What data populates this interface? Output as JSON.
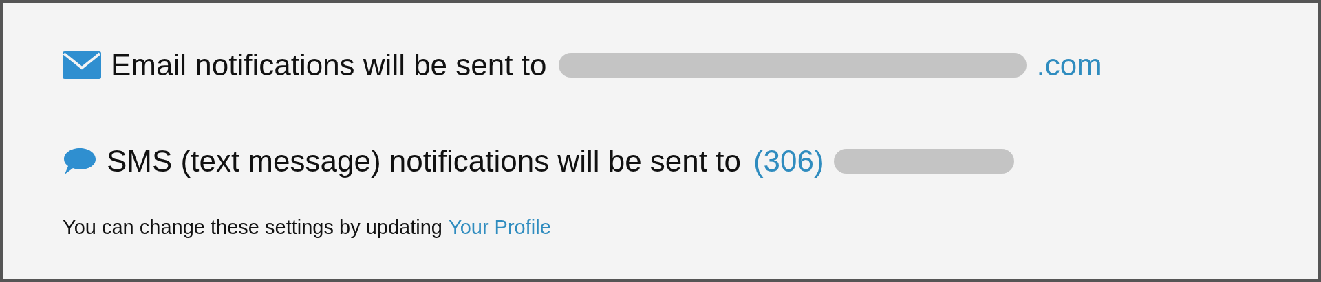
{
  "notifications": [
    {
      "kind": "email",
      "label": "Email notifications will be sent to",
      "contact": [
        {
          "kind": "redacted"
        },
        {
          "kind": "text",
          "text": ".com"
        }
      ]
    },
    {
      "kind": "sms",
      "label": "SMS (text message) notifications will be sent to",
      "contact": [
        {
          "kind": "text",
          "text": "(306)"
        },
        {
          "kind": "redacted"
        }
      ]
    }
  ],
  "footer": {
    "text": "You can change these settings by updating",
    "link": "Your Profile"
  }
}
